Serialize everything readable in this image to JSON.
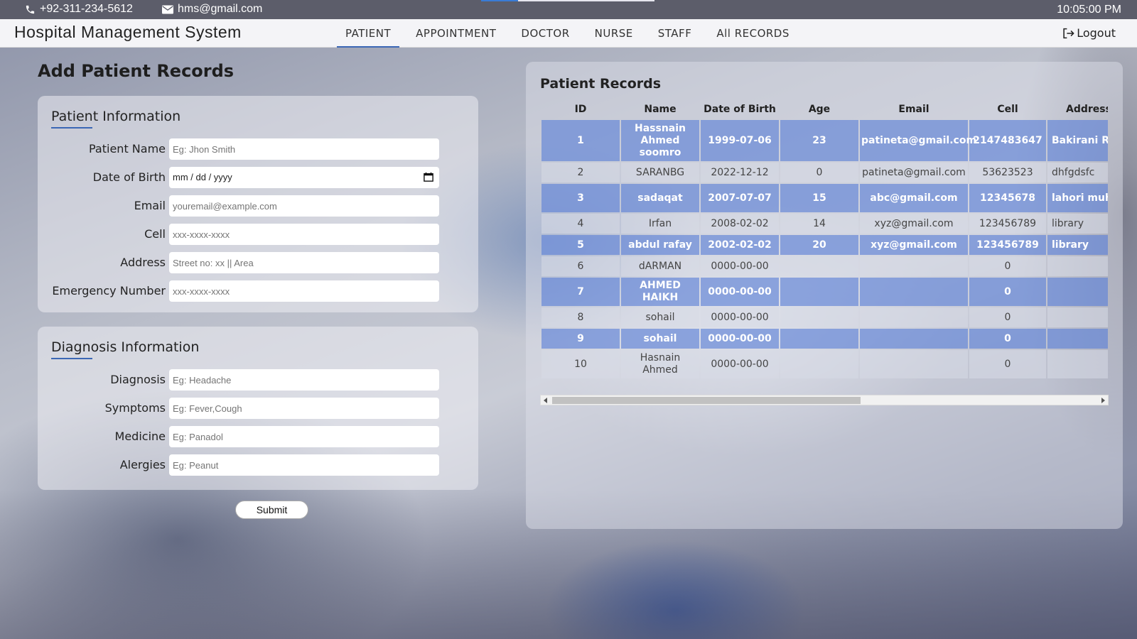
{
  "topbar": {
    "phone": "+92-311-234-5612",
    "email": "hms@gmail.com",
    "time": "10:05:00 PM"
  },
  "navbar": {
    "brand": "Hospital Management System",
    "items": [
      "PATIENT",
      "APPOINTMENT",
      "DOCTOR",
      "NURSE",
      "STAFF",
      "All RECORDS"
    ],
    "active": "PATIENT",
    "logout": "Logout"
  },
  "form": {
    "title": "Add Patient Records",
    "patient_section": {
      "title": "Patient Information",
      "fields": [
        {
          "label": "Patient Name",
          "placeholder": "Eg: Jhon Smith"
        },
        {
          "label": "Date of Birth",
          "placeholder": "mm / dd / yyyy"
        },
        {
          "label": "Email",
          "placeholder": "youremail@example.com"
        },
        {
          "label": "Cell",
          "placeholder": "xxx-xxxx-xxxx"
        },
        {
          "label": "Address",
          "placeholder": "Street no: xx || Area"
        },
        {
          "label": "Emergency Number",
          "placeholder": "xxx-xxxx-xxxx"
        }
      ]
    },
    "diagnosis_section": {
      "title": "Diagnosis Information",
      "fields": [
        {
          "label": "Diagnosis",
          "placeholder": "Eg: Headache"
        },
        {
          "label": "Symptoms",
          "placeholder": "Eg: Fever,Cough"
        },
        {
          "label": "Medicine",
          "placeholder": "Eg: Panadol"
        },
        {
          "label": "Alergies",
          "placeholder": "Eg: Peanut"
        }
      ]
    },
    "submit_label": "Submit"
  },
  "records": {
    "title": "Patient Records",
    "columns": [
      "ID",
      "Name",
      "Date of Birth",
      "Age",
      "Email",
      "Cell",
      "Address"
    ],
    "rows": [
      [
        "1",
        "Hassnain Ahmed soomro",
        "1999-07-06",
        "23",
        "patineta@gmail.com",
        "2147483647",
        "Bakirani Ro"
      ],
      [
        "2",
        "SARANBG",
        "2022-12-12",
        "0",
        "patineta@gmail.com",
        "53623523",
        "dhfgdsfc"
      ],
      [
        "3",
        "sadaqat",
        "2007-07-07",
        "15",
        "abc@gmail.com",
        "12345678",
        "lahori muha lrk"
      ],
      [
        "4",
        "Irfan",
        "2008-02-02",
        "14",
        "xyz@gmail.com",
        "123456789",
        "library"
      ],
      [
        "5",
        "abdul rafay",
        "2002-02-02",
        "20",
        "xyz@gmail.com",
        "123456789",
        "library"
      ],
      [
        "6",
        "dARMAN",
        "0000-00-00",
        "",
        "",
        "0",
        ""
      ],
      [
        "7",
        "AHMED HAIKH",
        "0000-00-00",
        "",
        "",
        "0",
        ""
      ],
      [
        "8",
        "sohail",
        "0000-00-00",
        "",
        "",
        "0",
        ""
      ],
      [
        "9",
        "sohail",
        "0000-00-00",
        "",
        "",
        "0",
        ""
      ],
      [
        "10",
        "Hasnain Ahmed",
        "0000-00-00",
        "",
        "",
        "0",
        ""
      ]
    ]
  },
  "icons": {
    "phone": "phone-icon",
    "mail": "mail-icon",
    "logout": "logout-icon",
    "calendar": "calendar-icon"
  },
  "colors": {
    "accent": "#3b67b5",
    "row_highlight": "#5f82d7"
  }
}
